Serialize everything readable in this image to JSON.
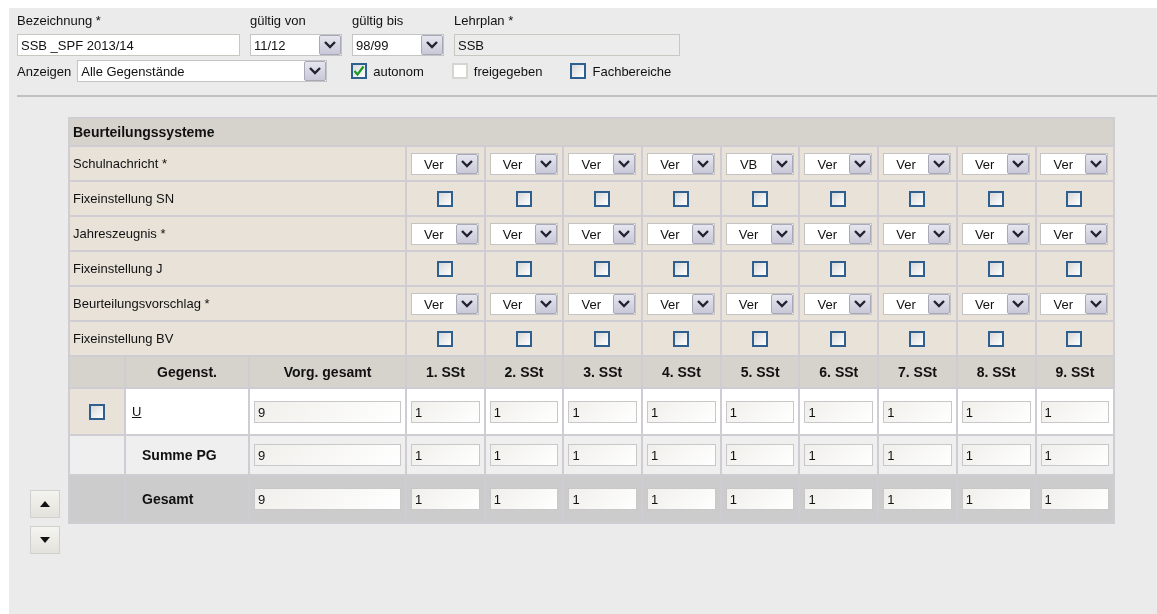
{
  "form": {
    "fields": [
      {
        "kind": "text",
        "label": "Bezeichnung *",
        "value": "SSB _SPF 2013/14",
        "disabled": false
      },
      {
        "kind": "select",
        "label": "gültig von",
        "value": "11/12"
      },
      {
        "kind": "select",
        "label": "gültig bis",
        "value": "98/99"
      },
      {
        "kind": "text",
        "label": "Lehrplan *",
        "value": "SSB",
        "disabled": true
      }
    ],
    "display": {
      "label": "Anzeigen",
      "value": "Alle Gegenstände"
    },
    "options": [
      {
        "label": "autonom",
        "checked": true,
        "disabled": false
      },
      {
        "label": "freigegeben",
        "checked": false,
        "disabled": true
      },
      {
        "label": "Fachbereiche",
        "checked": false,
        "disabled": false
      }
    ]
  },
  "table": {
    "title": "Beurteilungssysteme",
    "settings_rows": [
      {
        "kind": "select",
        "label": "Schulnachricht *",
        "values": [
          "Ver",
          "Ver",
          "Ver",
          "Ver",
          "VB",
          "Ver",
          "Ver",
          "Ver",
          "Ver"
        ]
      },
      {
        "kind": "checkbox",
        "label": "Fixeinstellung SN",
        "checked": [
          false,
          false,
          false,
          false,
          false,
          false,
          false,
          false,
          false
        ]
      },
      {
        "kind": "select",
        "label": "Jahreszeugnis *",
        "values": [
          "Ver",
          "Ver",
          "Ver",
          "Ver",
          "Ver",
          "Ver",
          "Ver",
          "Ver",
          "Ver"
        ]
      },
      {
        "kind": "checkbox",
        "label": "Fixeinstellung J",
        "checked": [
          false,
          false,
          false,
          false,
          false,
          false,
          false,
          false,
          false
        ]
      },
      {
        "kind": "select",
        "label": "Beurteilungsvorschlag *",
        "values": [
          "Ver",
          "Ver",
          "Ver",
          "Ver",
          "Ver",
          "Ver",
          "Ver",
          "Ver",
          "Ver"
        ]
      },
      {
        "kind": "checkbox",
        "label": "Fixeinstellung BV",
        "checked": [
          false,
          false,
          false,
          false,
          false,
          false,
          false,
          false,
          false
        ]
      }
    ],
    "columns": [
      "Gegenst.",
      "Vorg. gesamt",
      "1. SSt",
      "2. SSt",
      "3. SSt",
      "4. SSt",
      "5. SSt",
      "6. SSt",
      "7. SSt",
      "8. SSt",
      "9. SSt"
    ],
    "rows": [
      {
        "kind": "subject",
        "checked": false,
        "name": "U",
        "total": "9",
        "values": [
          "1",
          "1",
          "1",
          "1",
          "1",
          "1",
          "1",
          "1",
          "1"
        ]
      },
      {
        "kind": "sum",
        "name": "Summe PG",
        "total": "9",
        "values": [
          "1",
          "1",
          "1",
          "1",
          "1",
          "1",
          "1",
          "1",
          "1"
        ]
      },
      {
        "kind": "grand_total",
        "name": "Gesamt",
        "total": "9",
        "values": [
          "1",
          "1",
          "1",
          "1",
          "1",
          "1",
          "1",
          "1",
          "1"
        ]
      }
    ]
  }
}
